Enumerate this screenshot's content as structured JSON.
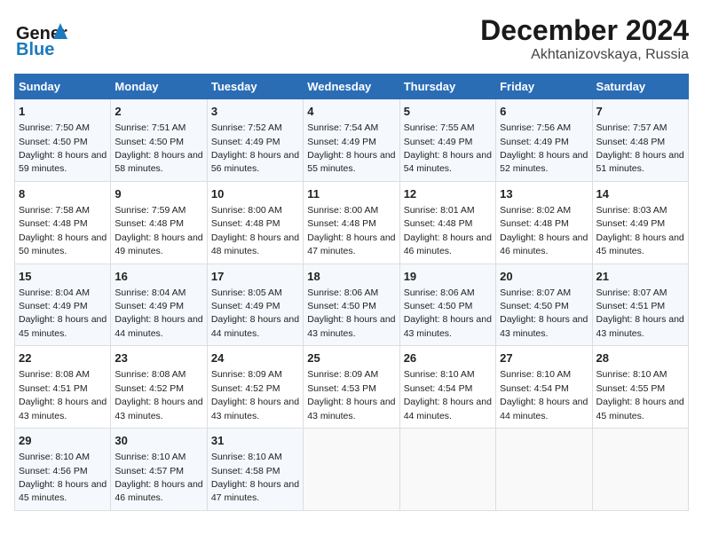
{
  "header": {
    "logo_general": "General",
    "logo_blue": "Blue",
    "title": "December 2024",
    "subtitle": "Akhtanizovskaya, Russia"
  },
  "calendar": {
    "weekdays": [
      "Sunday",
      "Monday",
      "Tuesday",
      "Wednesday",
      "Thursday",
      "Friday",
      "Saturday"
    ],
    "weeks": [
      [
        {
          "day": "1",
          "sunrise": "7:50 AM",
          "sunset": "4:50 PM",
          "daylight": "8 hours and 59 minutes."
        },
        {
          "day": "2",
          "sunrise": "7:51 AM",
          "sunset": "4:50 PM",
          "daylight": "8 hours and 58 minutes."
        },
        {
          "day": "3",
          "sunrise": "7:52 AM",
          "sunset": "4:49 PM",
          "daylight": "8 hours and 56 minutes."
        },
        {
          "day": "4",
          "sunrise": "7:54 AM",
          "sunset": "4:49 PM",
          "daylight": "8 hours and 55 minutes."
        },
        {
          "day": "5",
          "sunrise": "7:55 AM",
          "sunset": "4:49 PM",
          "daylight": "8 hours and 54 minutes."
        },
        {
          "day": "6",
          "sunrise": "7:56 AM",
          "sunset": "4:49 PM",
          "daylight": "8 hours and 52 minutes."
        },
        {
          "day": "7",
          "sunrise": "7:57 AM",
          "sunset": "4:48 PM",
          "daylight": "8 hours and 51 minutes."
        }
      ],
      [
        {
          "day": "8",
          "sunrise": "7:58 AM",
          "sunset": "4:48 PM",
          "daylight": "8 hours and 50 minutes."
        },
        {
          "day": "9",
          "sunrise": "7:59 AM",
          "sunset": "4:48 PM",
          "daylight": "8 hours and 49 minutes."
        },
        {
          "day": "10",
          "sunrise": "8:00 AM",
          "sunset": "4:48 PM",
          "daylight": "8 hours and 48 minutes."
        },
        {
          "day": "11",
          "sunrise": "8:00 AM",
          "sunset": "4:48 PM",
          "daylight": "8 hours and 47 minutes."
        },
        {
          "day": "12",
          "sunrise": "8:01 AM",
          "sunset": "4:48 PM",
          "daylight": "8 hours and 46 minutes."
        },
        {
          "day": "13",
          "sunrise": "8:02 AM",
          "sunset": "4:48 PM",
          "daylight": "8 hours and 46 minutes."
        },
        {
          "day": "14",
          "sunrise": "8:03 AM",
          "sunset": "4:49 PM",
          "daylight": "8 hours and 45 minutes."
        }
      ],
      [
        {
          "day": "15",
          "sunrise": "8:04 AM",
          "sunset": "4:49 PM",
          "daylight": "8 hours and 45 minutes."
        },
        {
          "day": "16",
          "sunrise": "8:04 AM",
          "sunset": "4:49 PM",
          "daylight": "8 hours and 44 minutes."
        },
        {
          "day": "17",
          "sunrise": "8:05 AM",
          "sunset": "4:49 PM",
          "daylight": "8 hours and 44 minutes."
        },
        {
          "day": "18",
          "sunrise": "8:06 AM",
          "sunset": "4:50 PM",
          "daylight": "8 hours and 43 minutes."
        },
        {
          "day": "19",
          "sunrise": "8:06 AM",
          "sunset": "4:50 PM",
          "daylight": "8 hours and 43 minutes."
        },
        {
          "day": "20",
          "sunrise": "8:07 AM",
          "sunset": "4:50 PM",
          "daylight": "8 hours and 43 minutes."
        },
        {
          "day": "21",
          "sunrise": "8:07 AM",
          "sunset": "4:51 PM",
          "daylight": "8 hours and 43 minutes."
        }
      ],
      [
        {
          "day": "22",
          "sunrise": "8:08 AM",
          "sunset": "4:51 PM",
          "daylight": "8 hours and 43 minutes."
        },
        {
          "day": "23",
          "sunrise": "8:08 AM",
          "sunset": "4:52 PM",
          "daylight": "8 hours and 43 minutes."
        },
        {
          "day": "24",
          "sunrise": "8:09 AM",
          "sunset": "4:52 PM",
          "daylight": "8 hours and 43 minutes."
        },
        {
          "day": "25",
          "sunrise": "8:09 AM",
          "sunset": "4:53 PM",
          "daylight": "8 hours and 43 minutes."
        },
        {
          "day": "26",
          "sunrise": "8:10 AM",
          "sunset": "4:54 PM",
          "daylight": "8 hours and 44 minutes."
        },
        {
          "day": "27",
          "sunrise": "8:10 AM",
          "sunset": "4:54 PM",
          "daylight": "8 hours and 44 minutes."
        },
        {
          "day": "28",
          "sunrise": "8:10 AM",
          "sunset": "4:55 PM",
          "daylight": "8 hours and 45 minutes."
        }
      ],
      [
        {
          "day": "29",
          "sunrise": "8:10 AM",
          "sunset": "4:56 PM",
          "daylight": "8 hours and 45 minutes."
        },
        {
          "day": "30",
          "sunrise": "8:10 AM",
          "sunset": "4:57 PM",
          "daylight": "8 hours and 46 minutes."
        },
        {
          "day": "31",
          "sunrise": "8:10 AM",
          "sunset": "4:58 PM",
          "daylight": "8 hours and 47 minutes."
        },
        null,
        null,
        null,
        null
      ]
    ]
  }
}
